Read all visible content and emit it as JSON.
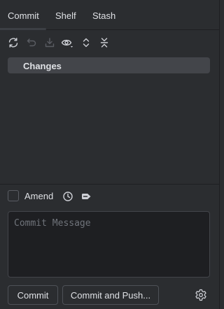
{
  "tabs": [
    {
      "label": "Commit",
      "active": true
    },
    {
      "label": "Shelf",
      "active": false
    },
    {
      "label": "Stash",
      "active": false
    }
  ],
  "toolbar": {
    "icons": [
      "refresh-icon",
      "rollback-icon",
      "download-icon",
      "eye-icon",
      "expand-all-icon",
      "collapse-all-icon"
    ]
  },
  "changes": {
    "label": "Changes"
  },
  "amend": {
    "label": "Amend",
    "checked": false
  },
  "commit_message": {
    "placeholder": "Commit Message",
    "value": ""
  },
  "buttons": {
    "commit": "Commit",
    "commit_and_push": "Commit and Push..."
  },
  "colors": {
    "background": "#2b2d30",
    "text": "#dfe1e5",
    "selection": "#43454a",
    "input_bg": "#1e1f22",
    "disabled_icon": "#5a5d63"
  }
}
